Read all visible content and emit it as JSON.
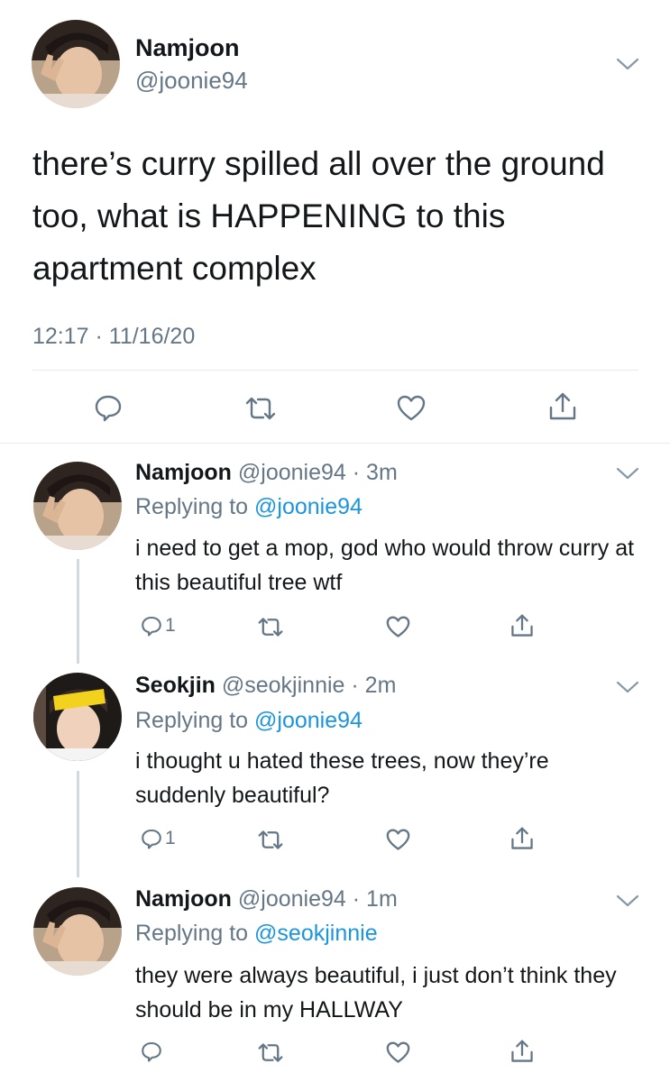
{
  "main_tweet": {
    "display_name": "Namjoon",
    "handle": "@joonie94",
    "text": "there’s curry spilled all over the ground too, what is HAPPENING to this apartment complex",
    "timestamp": "12:17 · 11/16/20",
    "actions": [
      "reply-icon",
      "retweet-icon",
      "like-icon",
      "share-icon"
    ]
  },
  "replies": [
    {
      "display_name": "Namjoon",
      "handle": "@joonie94",
      "time": "· 3m",
      "replying_prefix": "Replying to ",
      "replying_to": "@joonie94",
      "text": "i need to get a mop, god who would throw curry at this beautiful tree wtf",
      "reply_count": "1"
    },
    {
      "display_name": "Seokjin",
      "handle": "@seokjinnie",
      "time": "· 2m",
      "replying_prefix": "Replying to ",
      "replying_to": "@joonie94",
      "text": "i thought u hated these trees, now they’re suddenly beautiful?",
      "reply_count": "1"
    },
    {
      "display_name": "Namjoon",
      "handle": "@joonie94",
      "time": "· 1m",
      "replying_prefix": "Replying to ",
      "replying_to": "@seokjinnie",
      "text": "they were always beautiful, i just don’t think they should be in my HALLWAY",
      "reply_count": ""
    }
  ],
  "colors": {
    "link": "#1b95e0",
    "muted": "#657786",
    "divider": "#e6ecf0",
    "thread_line": "#cfd9de"
  }
}
